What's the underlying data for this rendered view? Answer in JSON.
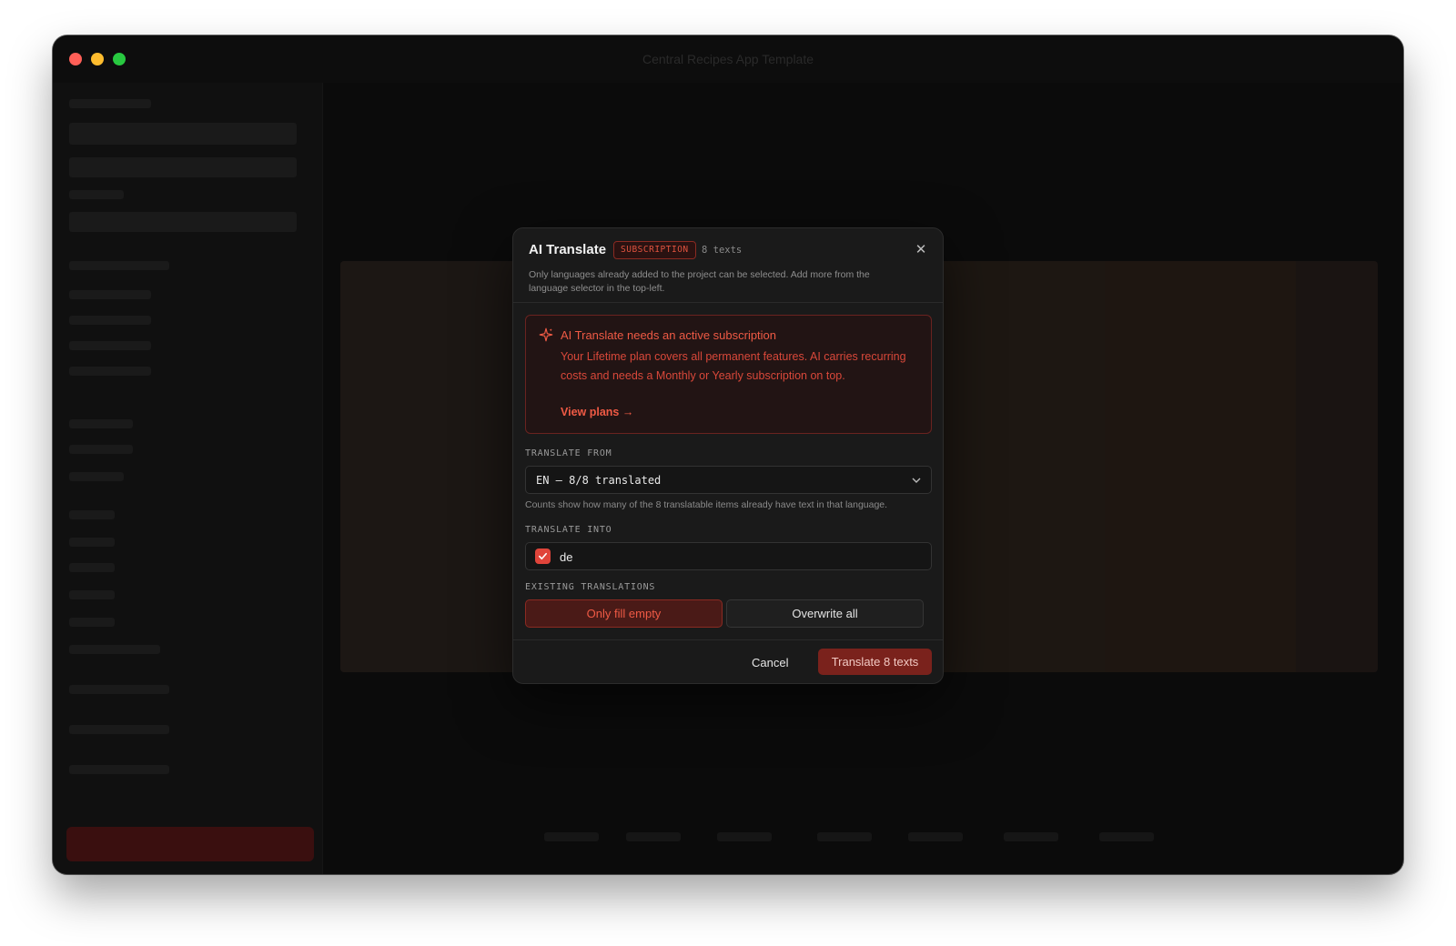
{
  "window": {
    "title": "Central Recipes App Template"
  },
  "dialog": {
    "title": "AI Translate",
    "badge": "SUBSCRIPTION",
    "text_count": "8 texts",
    "close_icon": "close-icon",
    "subtitle": "Only languages already added to the project can be selected. Add more from the language selector in the top-left."
  },
  "alert": {
    "icon": "sparkle-icon",
    "title": "AI Translate needs an active subscription",
    "body": "Your Lifetime plan covers all permanent features. AI carries recurring costs and needs a Monthly or Yearly subscription on top.",
    "link": "View plans →"
  },
  "translate_from": {
    "label": "TRANSLATE FROM",
    "value": "EN — 8/8 translated",
    "hint": "Counts show how many of the 8 translatable items already have text in that language."
  },
  "translate_into": {
    "label": "TRANSLATE INTO",
    "languages": [
      {
        "code": "de",
        "checked": true
      }
    ]
  },
  "existing": {
    "label": "EXISTING TRANSLATIONS",
    "options": [
      "Only fill empty",
      "Overwrite all"
    ],
    "selected": "Only fill empty"
  },
  "footer": {
    "cancel": "Cancel",
    "submit": "Translate 8 texts"
  },
  "colors": {
    "accent": "#e0443a",
    "dialog_bg": "#1a1a1a",
    "alert_text": "#ef5a45"
  }
}
